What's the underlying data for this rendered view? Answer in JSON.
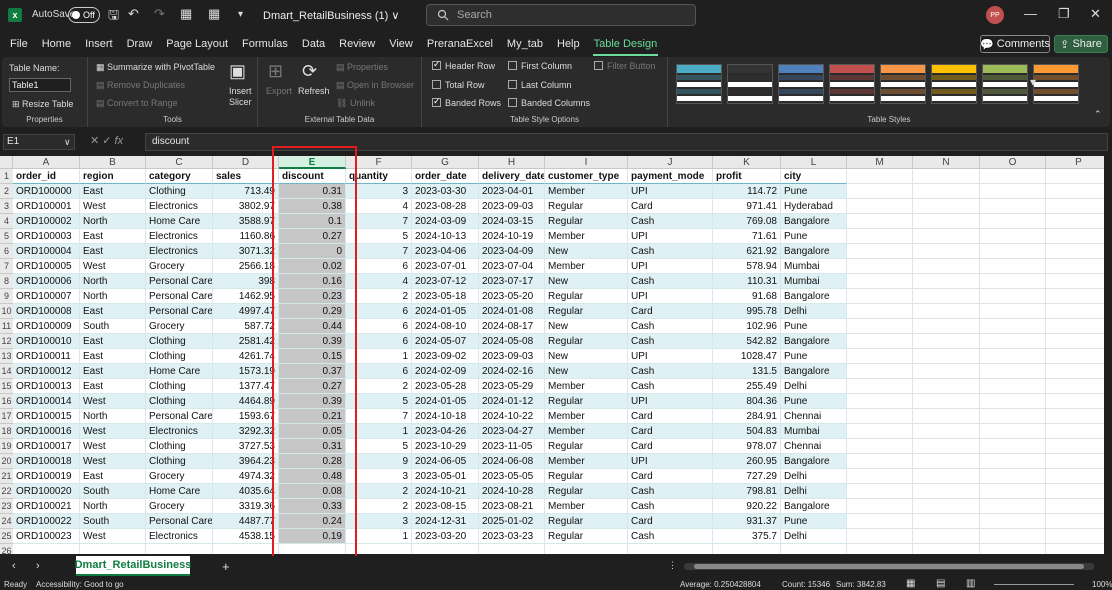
{
  "window": {
    "autosave_label": "AutoSave",
    "autosave_state": "Off",
    "title": "Dmart_RetailBusiness (1)",
    "title_chevron": "∨",
    "search_placeholder": "Search",
    "avatar": "PP"
  },
  "menu": [
    "File",
    "Home",
    "Insert",
    "Draw",
    "Page Layout",
    "Formulas",
    "Data",
    "Review",
    "View",
    "PreranaExcel",
    "My_tab",
    "Help",
    "Table Design"
  ],
  "menu_active": "Table Design",
  "buttons": {
    "comments": "Comments",
    "share": "Share"
  },
  "ribbon": {
    "properties": {
      "label": "Properties",
      "table_name_label": "Table Name:",
      "table_name": "Table1",
      "resize": "Resize Table"
    },
    "tools": {
      "label": "Tools",
      "summarize": "Summarize with PivotTable",
      "remove_duplicates": "Remove Duplicates",
      "convert": "Convert to Range",
      "insert_slicer_1": "Insert",
      "insert_slicer_2": "Slicer"
    },
    "external": {
      "label": "External Table Data",
      "export": "Export",
      "refresh": "Refresh",
      "properties": "Properties",
      "open_browser": "Open in Browser",
      "unlink": "Unlink"
    },
    "style_options": {
      "label": "Table Style Options",
      "header_row": "Header Row",
      "total_row": "Total Row",
      "banded_rows": "Banded Rows",
      "first_column": "First Column",
      "last_column": "Last Column",
      "banded_columns": "Banded Columns",
      "filter_button": "Filter Button"
    },
    "styles": {
      "label": "Table Styles",
      "colors": [
        "#4bacc6",
        "#333333",
        "#4f81bd",
        "#c0504d",
        "#f79646",
        "#ffc000",
        "#9bbb59",
        "#ff9933"
      ]
    }
  },
  "formula_bar": {
    "name_box": "E1",
    "fx": "fx",
    "content": "discount"
  },
  "columns": [
    "A",
    "B",
    "C",
    "D",
    "E",
    "F",
    "G",
    "H",
    "I",
    "J",
    "K",
    "L",
    "M",
    "N",
    "O",
    "P"
  ],
  "selected_column": "E",
  "headers": [
    "order_id",
    "region",
    "category",
    "sales",
    "discount",
    "quantity",
    "order_date",
    "delivery_date",
    "customer_type",
    "payment_mode",
    "profit",
    "city"
  ],
  "rows": [
    [
      "ORD100000",
      "East",
      "Clothing",
      "713.49",
      "0.31",
      "3",
      "2023-03-30",
      "2023-04-01",
      "Member",
      "UPI",
      "114.72",
      "Pune"
    ],
    [
      "ORD100001",
      "West",
      "Electronics",
      "3802.97",
      "0.38",
      "4",
      "2023-08-28",
      "2023-09-03",
      "Regular",
      "Card",
      "971.41",
      "Hyderabad"
    ],
    [
      "ORD100002",
      "North",
      "Home Care",
      "3588.97",
      "0.1",
      "7",
      "2024-03-09",
      "2024-03-15",
      "Regular",
      "Cash",
      "769.08",
      "Bangalore"
    ],
    [
      "ORD100003",
      "East",
      "Electronics",
      "1160.86",
      "0.27",
      "5",
      "2024-10-13",
      "2024-10-19",
      "Member",
      "UPI",
      "71.61",
      "Pune"
    ],
    [
      "ORD100004",
      "East",
      "Electronics",
      "3071.32",
      "0",
      "7",
      "2023-04-06",
      "2023-04-09",
      "New",
      "Cash",
      "621.92",
      "Bangalore"
    ],
    [
      "ORD100005",
      "West",
      "Grocery",
      "2566.18",
      "0.02",
      "6",
      "2023-07-01",
      "2023-07-04",
      "Member",
      "UPI",
      "578.94",
      "Mumbai"
    ],
    [
      "ORD100006",
      "North",
      "Personal Care",
      "398",
      "0.16",
      "4",
      "2023-07-12",
      "2023-07-17",
      "New",
      "Cash",
      "110.31",
      "Mumbai"
    ],
    [
      "ORD100007",
      "North",
      "Personal Care",
      "1462.95",
      "0.23",
      "2",
      "2023-05-18",
      "2023-05-20",
      "Regular",
      "UPI",
      "91.68",
      "Bangalore"
    ],
    [
      "ORD100008",
      "East",
      "Personal Care",
      "4997.47",
      "0.29",
      "6",
      "2024-01-05",
      "2024-01-08",
      "Regular",
      "Card",
      "995.78",
      "Delhi"
    ],
    [
      "ORD100009",
      "South",
      "Grocery",
      "587.72",
      "0.44",
      "6",
      "2024-08-10",
      "2024-08-17",
      "New",
      "Cash",
      "102.96",
      "Pune"
    ],
    [
      "ORD100010",
      "East",
      "Clothing",
      "2581.42",
      "0.39",
      "6",
      "2024-05-07",
      "2024-05-08",
      "Regular",
      "Cash",
      "542.82",
      "Bangalore"
    ],
    [
      "ORD100011",
      "East",
      "Clothing",
      "4261.74",
      "0.15",
      "1",
      "2023-09-02",
      "2023-09-03",
      "New",
      "UPI",
      "1028.47",
      "Pune"
    ],
    [
      "ORD100012",
      "East",
      "Home Care",
      "1573.19",
      "0.37",
      "6",
      "2024-02-09",
      "2024-02-16",
      "New",
      "Cash",
      "131.5",
      "Bangalore"
    ],
    [
      "ORD100013",
      "East",
      "Clothing",
      "1377.47",
      "0.27",
      "2",
      "2023-05-28",
      "2023-05-29",
      "Member",
      "Cash",
      "255.49",
      "Delhi"
    ],
    [
      "ORD100014",
      "West",
      "Clothing",
      "4464.89",
      "0.39",
      "5",
      "2024-01-05",
      "2024-01-12",
      "Regular",
      "UPI",
      "804.36",
      "Pune"
    ],
    [
      "ORD100015",
      "North",
      "Personal Care",
      "1593.67",
      "0.21",
      "7",
      "2024-10-18",
      "2024-10-22",
      "Member",
      "Card",
      "284.91",
      "Chennai"
    ],
    [
      "ORD100016",
      "West",
      "Electronics",
      "3292.32",
      "0.05",
      "1",
      "2023-04-26",
      "2023-04-27",
      "Member",
      "Card",
      "504.83",
      "Mumbai"
    ],
    [
      "ORD100017",
      "West",
      "Clothing",
      "3727.53",
      "0.31",
      "5",
      "2023-10-29",
      "2023-11-05",
      "Regular",
      "Card",
      "978.07",
      "Chennai"
    ],
    [
      "ORD100018",
      "West",
      "Clothing",
      "3964.23",
      "0.28",
      "9",
      "2024-06-05",
      "2024-06-08",
      "Member",
      "UPI",
      "260.95",
      "Bangalore"
    ],
    [
      "ORD100019",
      "East",
      "Grocery",
      "4974.32",
      "0.48",
      "3",
      "2023-05-01",
      "2023-05-05",
      "Regular",
      "Card",
      "727.29",
      "Delhi"
    ],
    [
      "ORD100020",
      "South",
      "Home Care",
      "4035.64",
      "0.08",
      "2",
      "2024-10-21",
      "2024-10-28",
      "Regular",
      "Cash",
      "798.81",
      "Delhi"
    ],
    [
      "ORD100021",
      "North",
      "Grocery",
      "3319.36",
      "0.33",
      "2",
      "2023-08-15",
      "2023-08-21",
      "Member",
      "Cash",
      "920.22",
      "Bangalore"
    ],
    [
      "ORD100022",
      "South",
      "Personal Care",
      "4487.77",
      "0.24",
      "3",
      "2024-12-31",
      "2025-01-02",
      "Regular",
      "Card",
      "931.37",
      "Pune"
    ],
    [
      "ORD100023",
      "West",
      "Electronics",
      "4538.15",
      "0.19",
      "1",
      "2023-03-20",
      "2023-03-23",
      "Regular",
      "Cash",
      "375.7",
      "Delhi"
    ]
  ],
  "sheet_tab": "Dmart_RetailBusiness",
  "status": {
    "ready": "Ready",
    "accessibility": "Accessibility: Good to go",
    "average": "Average: 0.250428804",
    "count": "Count: 15346",
    "sum": "Sum: 3842.83",
    "zoom": "100%"
  }
}
